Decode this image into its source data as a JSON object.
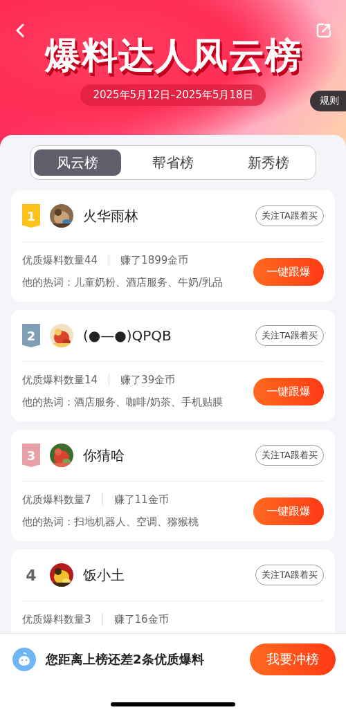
{
  "header": {
    "title": "爆料达人风云榜",
    "date_range": "2025年5月12日–2025年5月18日",
    "rules_label": "规则"
  },
  "tabs": [
    {
      "label": "风云榜",
      "selected": true
    },
    {
      "label": "帮省榜",
      "selected": false
    },
    {
      "label": "新秀榜",
      "selected": false
    }
  ],
  "entries": [
    {
      "rank": {
        "number": "1",
        "kind": "medal",
        "color": "#ffc21a"
      },
      "name": "火华雨林",
      "follow_label": "关注TA跟着买",
      "quality_count": "优质爆料数量44",
      "earned": "赚了1899金币",
      "hot_words": "他的热词：儿童奶粉、酒店服务、牛奶/乳品",
      "action_label": "一键跟爆"
    },
    {
      "rank": {
        "number": "2",
        "kind": "medal",
        "color": "#7f9fb5"
      },
      "name": "(●—●)QPQB",
      "follow_label": "关注TA跟着买",
      "quality_count": "优质爆料数量14",
      "earned": "赚了39金币",
      "hot_words": "他的热词：酒店服务、咖啡/奶茶、手机贴膜",
      "action_label": "一键跟爆"
    },
    {
      "rank": {
        "number": "3",
        "kind": "medal",
        "color": "#e8a0a8"
      },
      "name": "你猜哈",
      "follow_label": "关注TA跟着买",
      "quality_count": "优质爆料数量7",
      "earned": "赚了11金币",
      "hot_words": "他的热词：扫地机器人、空调、猕猴桃",
      "action_label": "一键跟爆"
    },
    {
      "rank": {
        "number": "4",
        "kind": "plain"
      },
      "name": "饭小土",
      "follow_label": "关注TA跟着买",
      "quality_count": "优质爆料数量3",
      "earned": "赚了16金币"
    }
  ],
  "bottom_bar": {
    "message": "您距离上榜还差2条优质爆料",
    "button_label": "我要冲榜"
  }
}
